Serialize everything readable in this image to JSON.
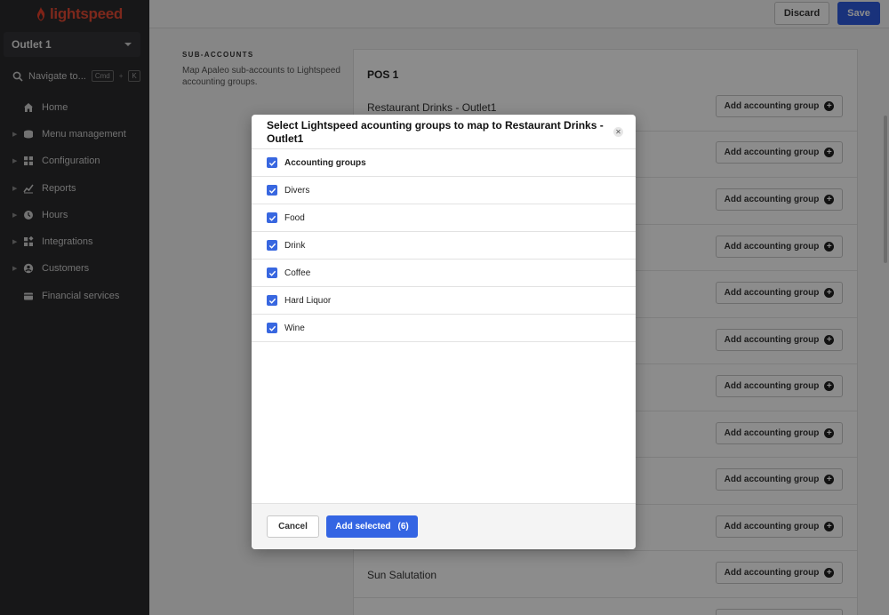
{
  "app": {
    "brand": "lightspeed",
    "brand_color": "#e8412a"
  },
  "sidebar": {
    "outlet": "Outlet 1",
    "navigate": "Navigate to...",
    "kbd": [
      "Cmd",
      "K"
    ],
    "items": [
      {
        "label": "Home",
        "icon": "home-icon",
        "expandable": false
      },
      {
        "label": "Menu management",
        "icon": "menu-icon",
        "expandable": true
      },
      {
        "label": "Configuration",
        "icon": "grid-icon",
        "expandable": true
      },
      {
        "label": "Reports",
        "icon": "chart-icon",
        "expandable": true
      },
      {
        "label": "Hours",
        "icon": "clock-icon",
        "expandable": true
      },
      {
        "label": "Integrations",
        "icon": "integrations-icon",
        "expandable": true
      },
      {
        "label": "Customers",
        "icon": "user-icon",
        "expandable": true
      },
      {
        "label": "Financial services",
        "icon": "wallet-icon",
        "expandable": false
      }
    ]
  },
  "topbar": {
    "discard": "Discard",
    "save": "Save"
  },
  "main": {
    "section_heading": "SUB-ACCOUNTS",
    "section_desc": "Map Apaleo sub-accounts to Lightspeed accounting groups.",
    "pos_title": "POS 1",
    "rows": [
      {
        "label": "Restaurant Drinks - Outlet1"
      },
      {
        "label": ""
      },
      {
        "label": ""
      },
      {
        "label": ""
      },
      {
        "label": ""
      },
      {
        "label": ""
      },
      {
        "label": ""
      },
      {
        "label": ""
      },
      {
        "label": ""
      },
      {
        "label": ""
      },
      {
        "label": "Sun Salutation"
      }
    ],
    "add_group_label": "Add accounting group"
  },
  "modal": {
    "title": "Select Lightspeed acounting groups to map to Restaurant Drinks - Outlet1",
    "items": [
      {
        "label": "Accounting groups",
        "checked": true,
        "header": true
      },
      {
        "label": "Divers",
        "checked": true
      },
      {
        "label": "Food",
        "checked": true
      },
      {
        "label": "Drink",
        "checked": true
      },
      {
        "label": "Coffee",
        "checked": true
      },
      {
        "label": "Hard Liquor",
        "checked": true
      },
      {
        "label": "Wine",
        "checked": true
      }
    ],
    "cancel": "Cancel",
    "add_selected": "Add selected",
    "selected_count": "(6)"
  }
}
